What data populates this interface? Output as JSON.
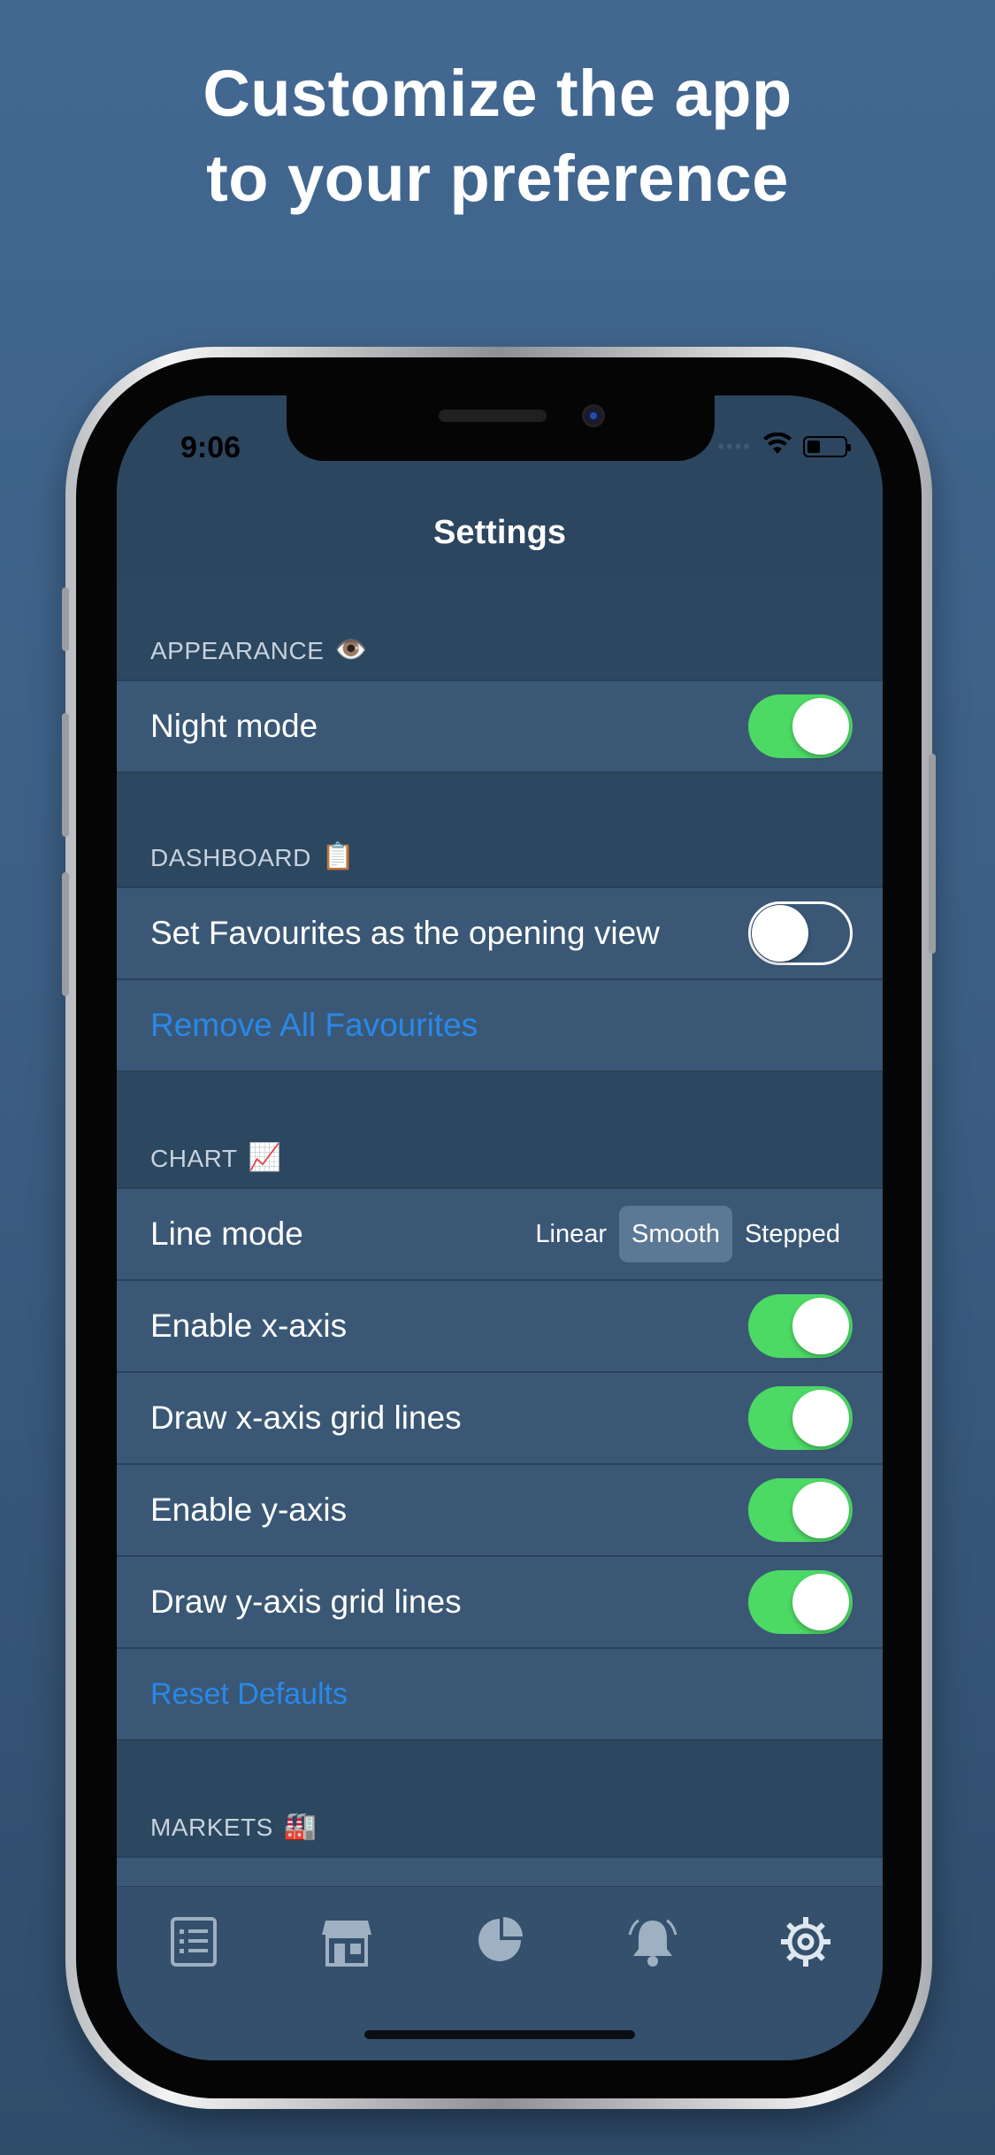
{
  "headline": {
    "line1": "Customize the app",
    "line2": "to your preference"
  },
  "status_bar": {
    "time": "9:06",
    "dots": "••••"
  },
  "nav": {
    "title": "Settings"
  },
  "sections": {
    "appearance": {
      "title": "APPEARANCE",
      "emoji": "👁️"
    },
    "dashboard": {
      "title": "DASHBOARD",
      "emoji": "📋"
    },
    "chart": {
      "title": "CHART",
      "emoji": "📈"
    },
    "markets": {
      "title": "MARKETS",
      "emoji": "🏭"
    }
  },
  "rows": {
    "night_mode": {
      "label": "Night mode",
      "on": true
    },
    "favourites_opening": {
      "label": "Set Favourites as the opening view",
      "on": false
    },
    "remove_favourites": {
      "label": "Remove All Favourites"
    },
    "line_mode": {
      "label": "Line mode",
      "options": [
        "Linear",
        "Smooth",
        "Stepped"
      ],
      "selected": "Smooth"
    },
    "enable_x_axis": {
      "label": "Enable x-axis",
      "on": true
    },
    "x_grid": {
      "label": "Draw x-axis grid lines",
      "on": true
    },
    "enable_y_axis": {
      "label": "Enable y-axis",
      "on": true
    },
    "y_grid": {
      "label": "Draw y-axis grid lines",
      "on": true
    },
    "reset_defaults": {
      "label": "Reset Defaults"
    }
  },
  "tabbar": {
    "icons": [
      "list-icon",
      "store-icon",
      "pie-chart-icon",
      "bell-icon",
      "gear-icon"
    ],
    "active": "gear-icon"
  },
  "colors": {
    "toggle_on": "#4cd964",
    "link": "#2a88e8",
    "background": "#3a5875"
  }
}
